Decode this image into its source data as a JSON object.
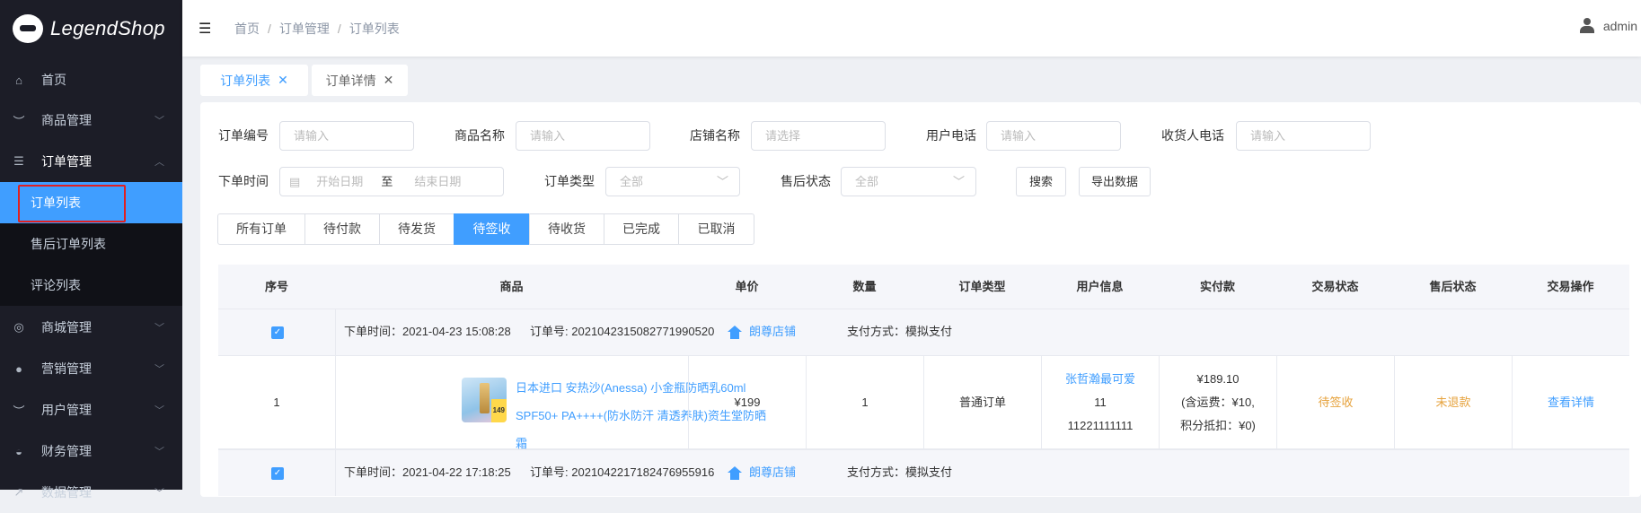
{
  "brand": "LegendShop",
  "sidebar": {
    "items": [
      {
        "label": "首页",
        "icon": "home-icon"
      },
      {
        "label": "商品管理",
        "icon": "eye-closed-icon"
      },
      {
        "label": "订单管理",
        "icon": "list-icon"
      },
      {
        "label": "订单列表"
      },
      {
        "label": "售后订单列表"
      },
      {
        "label": "评论列表"
      },
      {
        "label": "商城管理",
        "icon": "lifebuoy-icon"
      },
      {
        "label": "营销管理",
        "icon": "user-icon"
      },
      {
        "label": "用户管理",
        "icon": "eye-closed-icon"
      },
      {
        "label": "财务管理",
        "icon": "dashboard-icon"
      },
      {
        "label": "数据管理",
        "icon": "external-link-icon"
      }
    ]
  },
  "header": {
    "breadcrumb": [
      "首页",
      "订单管理",
      "订单列表"
    ],
    "user": "admin"
  },
  "page_tabs": [
    {
      "label": "订单列表"
    },
    {
      "label": "订单详情"
    }
  ],
  "filters": {
    "order_no": {
      "label": "订单编号",
      "placeholder": "请输入"
    },
    "product_name": {
      "label": "商品名称",
      "placeholder": "请输入"
    },
    "shop_name": {
      "label": "店铺名称",
      "placeholder": "请选择"
    },
    "user_phone": {
      "label": "用户电话",
      "placeholder": "请输入"
    },
    "receiver_phone": {
      "label": "收货人电话",
      "placeholder": "请输入"
    },
    "order_time": {
      "label": "下单时间",
      "start": "开始日期",
      "sep": "至",
      "end": "结束日期"
    },
    "order_type": {
      "label": "订单类型",
      "value": "全部"
    },
    "after_sale": {
      "label": "售后状态",
      "value": "全部"
    },
    "search": "搜索",
    "export": "导出数据"
  },
  "status_tabs": [
    "所有订单",
    "待付款",
    "待发货",
    "待签收",
    "待收货",
    "已完成",
    "已取消"
  ],
  "table": {
    "columns": [
      "序号",
      "商品",
      "单价",
      "数量",
      "订单类型",
      "用户信息",
      "实付款",
      "交易状态",
      "售后状态",
      "交易操作"
    ],
    "orders": [
      {
        "time_label": "下单时间：",
        "time": "2021-04-23 15:08:28",
        "no_label": "订单号:",
        "no": "2021042315082771990520",
        "shop": "朗尊店铺",
        "pay": "支付方式：模拟支付",
        "item": {
          "index": "1",
          "name": "日本进口 安热沙(Anessa) 小金瓶防晒乳60ml SPF50+ PA++++(防水防汗 清透养肤)资生堂防晒霜",
          "price": "¥199",
          "qty": "1",
          "type": "普通订单",
          "user_name": "张哲瀚最可爱",
          "user_id": "11",
          "user_phone": "11221111111",
          "paid": "¥189.10",
          "freight": "(含运费：¥10,",
          "points": "积分抵扣：¥0)",
          "status": "待签收",
          "after_sale": "未退款",
          "action": "查看详情"
        }
      },
      {
        "time_label": "下单时间：",
        "time": "2021-04-22 17:18:25",
        "no_label": "订单号:",
        "no": "2021042217182476955916",
        "shop": "朗尊店铺",
        "pay": "支付方式：模拟支付"
      }
    ]
  },
  "colors": {
    "primary": "#409eff",
    "warning": "#e6a23c",
    "sidebar": "#1c1d27"
  }
}
